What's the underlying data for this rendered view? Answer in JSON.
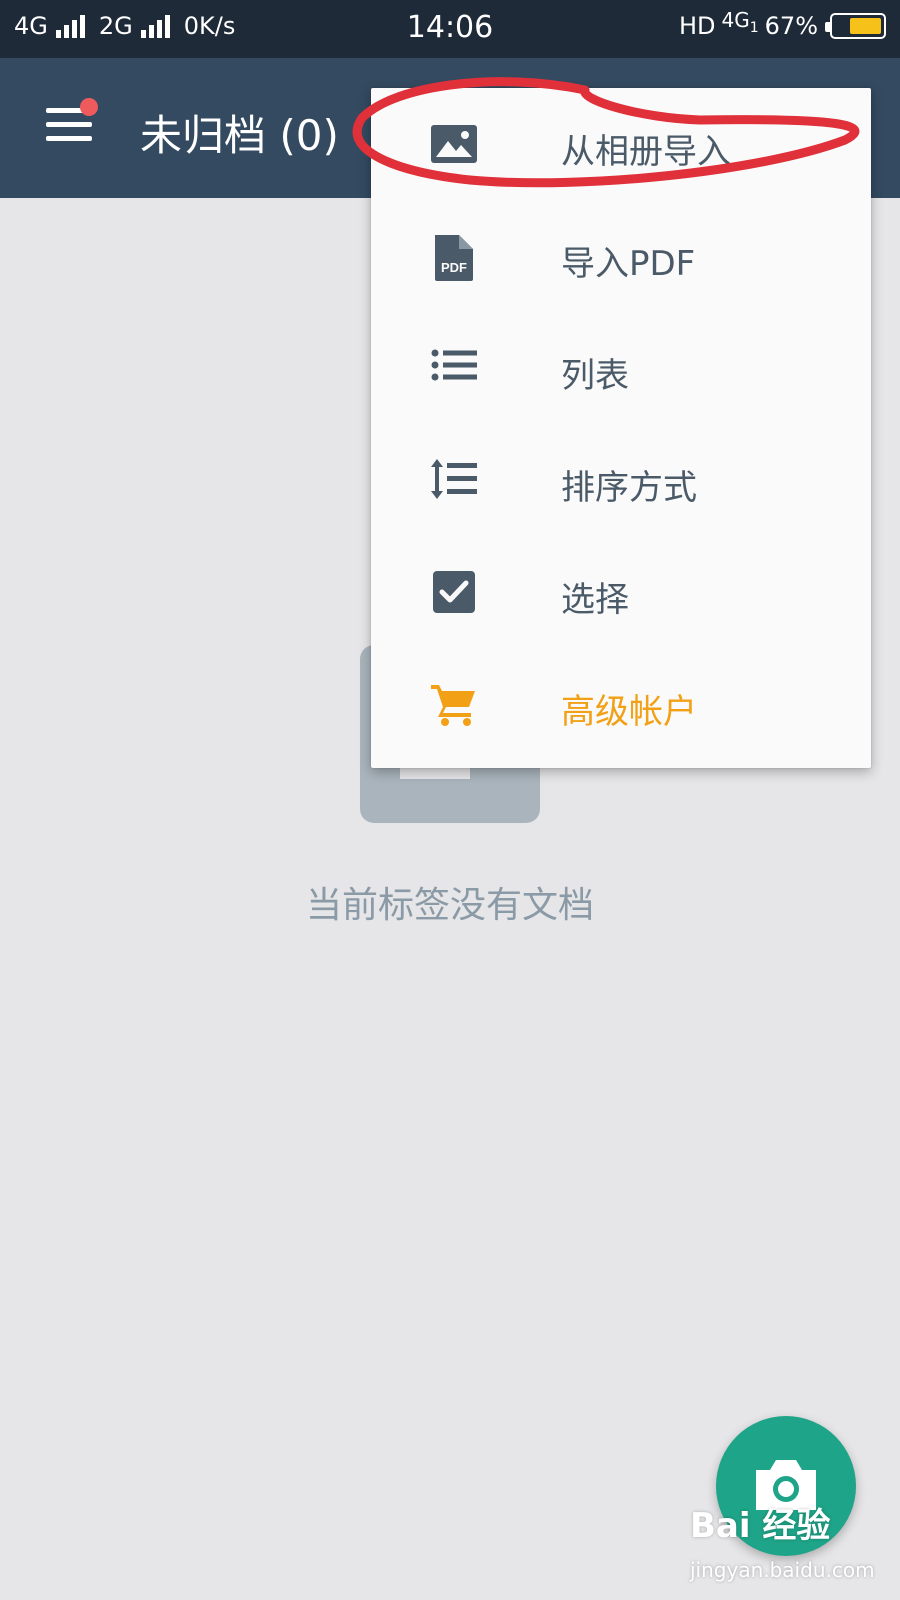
{
  "status_bar": {
    "net1": "4G",
    "net2": "2G",
    "speed": "0K/s",
    "time": "14:06",
    "hd": "HD",
    "net_type": "4G",
    "sim": "1",
    "battery": "67%",
    "battery_level": 0.67
  },
  "toolbar": {
    "title": "未归档 (0)"
  },
  "menu": {
    "items": [
      {
        "label": "从相册导入",
        "icon": "image-icon"
      },
      {
        "label": "导入PDF",
        "icon": "pdf-file-icon",
        "icon_text": "PDF"
      },
      {
        "label": "列表",
        "icon": "list-icon"
      },
      {
        "label": "排序方式",
        "icon": "sort-icon"
      },
      {
        "label": "选择",
        "icon": "checkbox-checked-icon"
      },
      {
        "label": "高级帐户",
        "icon": "cart-icon"
      }
    ]
  },
  "empty_state": {
    "message": "当前标签没有文档"
  },
  "fab": {
    "icon": "camera-icon"
  },
  "watermark": {
    "logo": "Bai 经验",
    "url": "jingyan.baidu.com"
  },
  "colors": {
    "status_bar": "#1e2a37",
    "toolbar": "#344a60",
    "background": "#e6e5e7",
    "menu_text": "#4a5a68",
    "premium": "#f2a015",
    "fab": "#1ea488",
    "annotation": "#e0303a",
    "badge_dot": "#ef5a5c"
  }
}
